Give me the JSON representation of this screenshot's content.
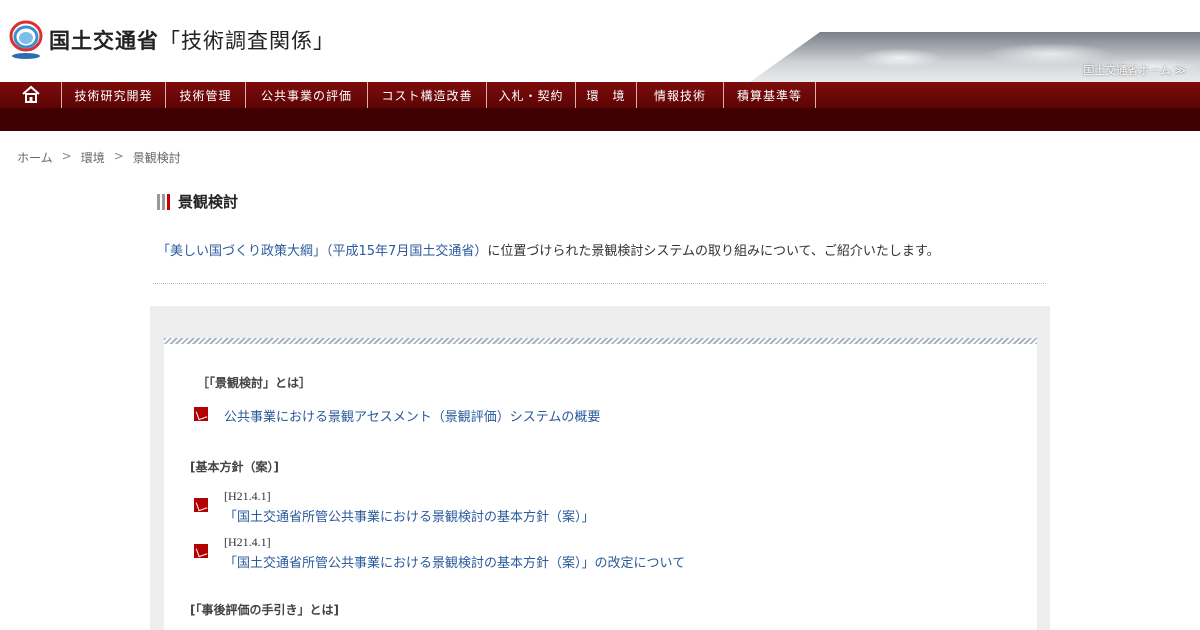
{
  "header": {
    "org_name": "国土交通省",
    "section_name": "「技術調査関係」",
    "home_link": "国土交通省ホーム ≫"
  },
  "nav": {
    "home_icon": "house-icon",
    "items": [
      {
        "label": "技術研究開発"
      },
      {
        "label": "技術管理"
      },
      {
        "label": "公共事業の評価"
      },
      {
        "label": "コスト構造改善"
      },
      {
        "label": "入札・契約"
      },
      {
        "label": "環　境"
      },
      {
        "label": "情報技術"
      },
      {
        "label": "積算基準等"
      }
    ]
  },
  "breadcrumb": {
    "home": "ホーム",
    "sep": ">",
    "level1": "環境",
    "current": "景観検討"
  },
  "page": {
    "title": "景観検討",
    "intro_link": "「美しい国づくり政策大綱」（平成15年7月国土交通省）",
    "intro_text": "に位置づけられた景観検討システムの取り組みについて、ご紹介いたします。"
  },
  "content": {
    "section1": {
      "heading": "［「景観検討」とは］",
      "doc_link": "公共事業における景観アセスメント（景観評価）システムの概要"
    },
    "section2": {
      "heading": "[基本方針（案）]",
      "docs": [
        {
          "date": "[H21.4.1]",
          "link": "「国土交通省所管公共事業における景観検討の基本方針（案）」",
          "suffix": ""
        },
        {
          "date": "[H21.4.1]",
          "link": "「国土交通省所管公共事業における景観検討の基本方針（案）」",
          "suffix": "の改定について"
        }
      ]
    },
    "section3": {
      "heading": "[「事後評価の手引き」とは]"
    }
  },
  "colors": {
    "nav_bg": "#6e0808",
    "subnav_bg": "#3f0101",
    "link": "#2a5a9c",
    "pdf_icon": "#b30000"
  }
}
